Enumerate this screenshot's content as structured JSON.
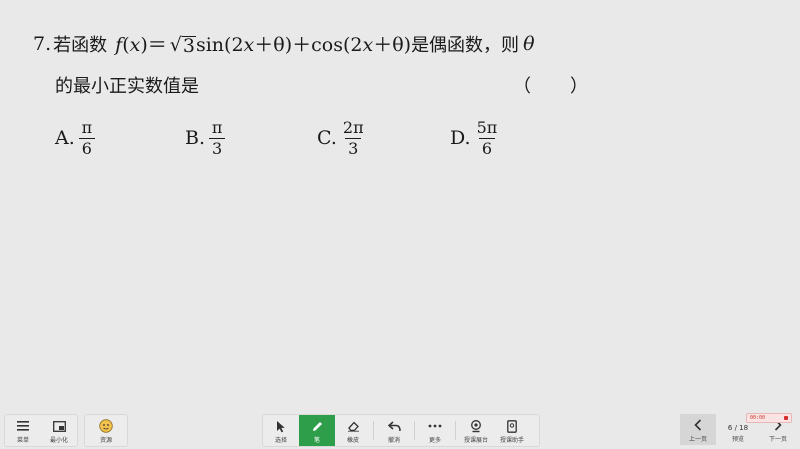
{
  "question": {
    "number": "7.",
    "intro": "若函数",
    "func_name": "f",
    "var": "x",
    "lparen": "(",
    "rparen": ")",
    "equals": "＝",
    "sqrt_radicand": "3",
    "sin_expr": "sin(2",
    "theta_part1": "＋θ)",
    "plus": "＋",
    "cos_expr": "cos(2",
    "theta_part2": "＋θ)",
    "clause": "是偶函数，则",
    "theta": "θ",
    "line2": "的最小正实数值是",
    "answer_blank": "（　　）"
  },
  "options": [
    {
      "letter": "A.",
      "numerator": "π",
      "denominator": "6"
    },
    {
      "letter": "B.",
      "numerator": "π",
      "denominator": "3"
    },
    {
      "letter": "C.",
      "numerator": "2π",
      "denominator": "3"
    },
    {
      "letter": "D.",
      "numerator": "5π",
      "denominator": "6"
    }
  ],
  "toolbar": {
    "left": [
      {
        "label": "菜单",
        "icon": "menu-icon"
      },
      {
        "label": "最小化",
        "icon": "minimize-icon"
      }
    ],
    "left2": [
      {
        "label": "资源",
        "icon": "avatar-icon"
      }
    ],
    "center": [
      {
        "label": "选择",
        "icon": "cursor-icon"
      },
      {
        "label": "笔",
        "icon": "pen-icon"
      },
      {
        "label": "橡皮",
        "icon": "eraser-icon"
      },
      {
        "label": "撤消",
        "icon": "undo-icon"
      },
      {
        "label": "更多",
        "icon": "more-icon"
      },
      {
        "label": "授课展台",
        "icon": "camera-icon"
      },
      {
        "label": "授课助手",
        "icon": "phone-icon"
      }
    ],
    "right": [
      {
        "label": "上一页",
        "icon": "chevron-left-icon"
      },
      {
        "label": "预览",
        "page": "6 / 18"
      },
      {
        "label": "下一页",
        "icon": "chevron-right-icon"
      }
    ],
    "recording_time": "00:00"
  },
  "colors": {
    "background": "#e9e9e9",
    "active_tool": "#2e9e4a",
    "record_red": "#d62d2d"
  }
}
